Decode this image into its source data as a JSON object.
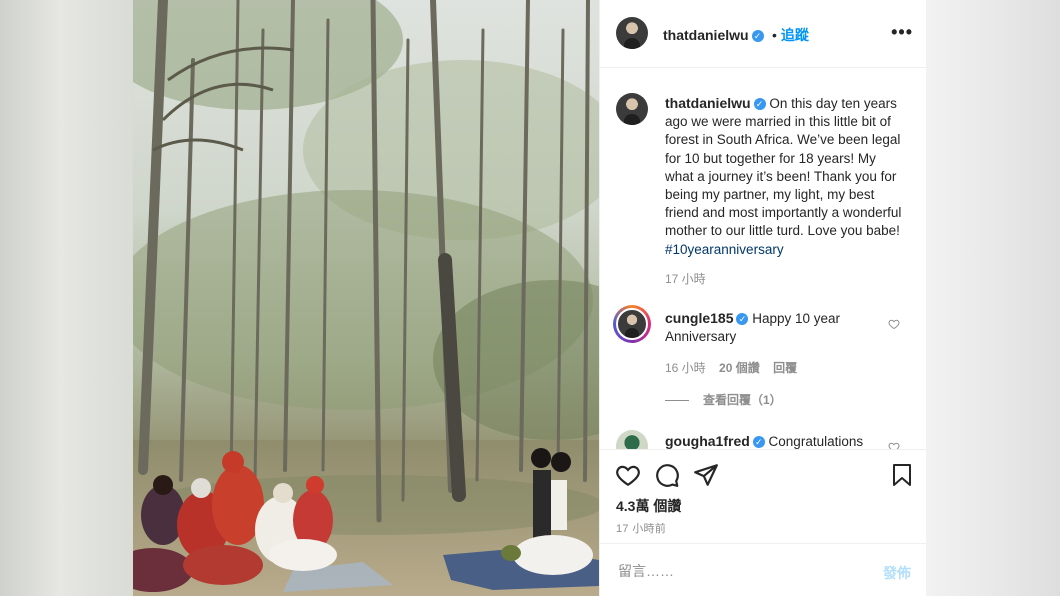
{
  "post": {
    "author": "thatdanielwu",
    "follow_label": "追蹤",
    "more_icon": "more-horizontal-icon",
    "caption_main": "On this day ten years ago we were married in this little bit of forest in South Africa. We’ve been legal for 10 but together for 18 years! My what a journey it’s been! Thank you for being my partner, my light, my best friend and most importantly a wonderful mother to our little turd. Love you babe! ",
    "caption_hashtag": "#10yearanniversary",
    "caption_time": "17 小時"
  },
  "comments": [
    {
      "user": "cungle185",
      "text": "Happy 10 year Anniversary",
      "time": "16 小時",
      "likes": "20 個讚",
      "reply_label": "回覆",
      "view_replies": "查看回覆（1）"
    },
    {
      "user": "gougha1fred",
      "text": "Congratulations"
    }
  ],
  "actions": {
    "likes": "4.3萬 個讚",
    "posted": "17 小時前"
  },
  "composer": {
    "placeholder": "留言……",
    "post_label": "發佈"
  },
  "colors": {
    "accent": "#0095f6",
    "verified": "#3897f0",
    "muted": "#8e8e8e",
    "disabled_post": "#b2dffc"
  }
}
